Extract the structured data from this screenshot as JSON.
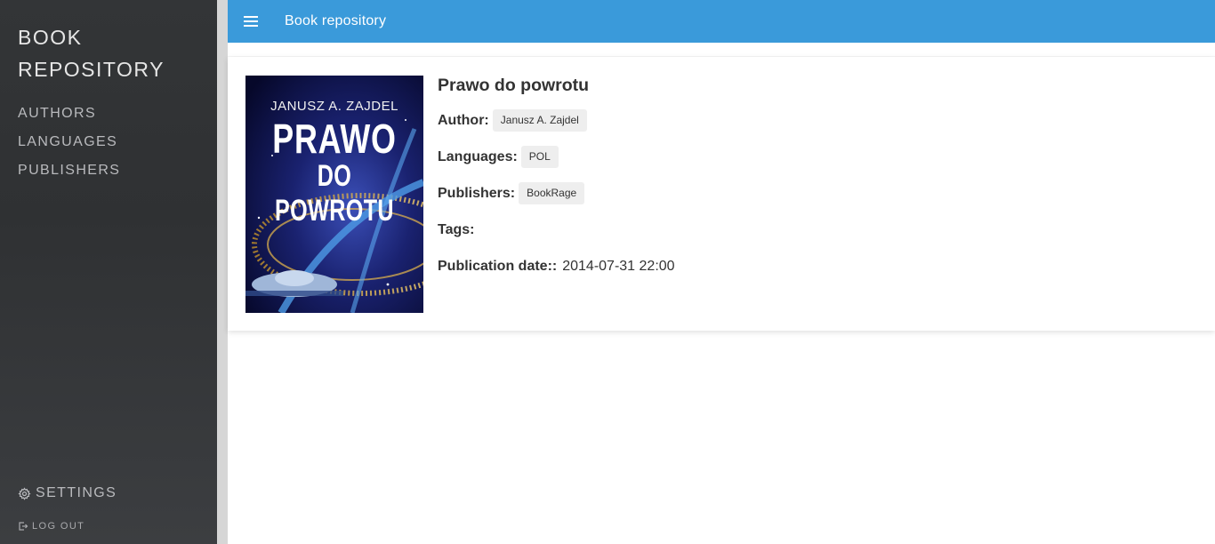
{
  "sidebar": {
    "brand": "BOOK REPOSITORY",
    "items": [
      {
        "label": "AUTHORS"
      },
      {
        "label": "LANGUAGES"
      },
      {
        "label": "PUBLISHERS"
      }
    ],
    "settings_label": "SETTINGS",
    "logout_label": "LOG OUT"
  },
  "topbar": {
    "title": "Book repository"
  },
  "book": {
    "title": "Prawo do powrotu",
    "cover": {
      "author_text": "JANUSZ A. ZAJDEL",
      "title_line1": "PRAWO",
      "title_line2": "DO POWROTU"
    },
    "author_label": "Author:",
    "author": "Janusz A. Zajdel",
    "languages_label": "Languages:",
    "language": "POL",
    "publishers_label": "Publishers:",
    "publisher": "BookRage",
    "tags_label": "Tags:",
    "date_label": "Publication date::",
    "date": "2014-07-31 22:00"
  },
  "colors": {
    "topbar": "#3a9ada",
    "sidebar": "#323436",
    "chip": "#eeeeee"
  }
}
